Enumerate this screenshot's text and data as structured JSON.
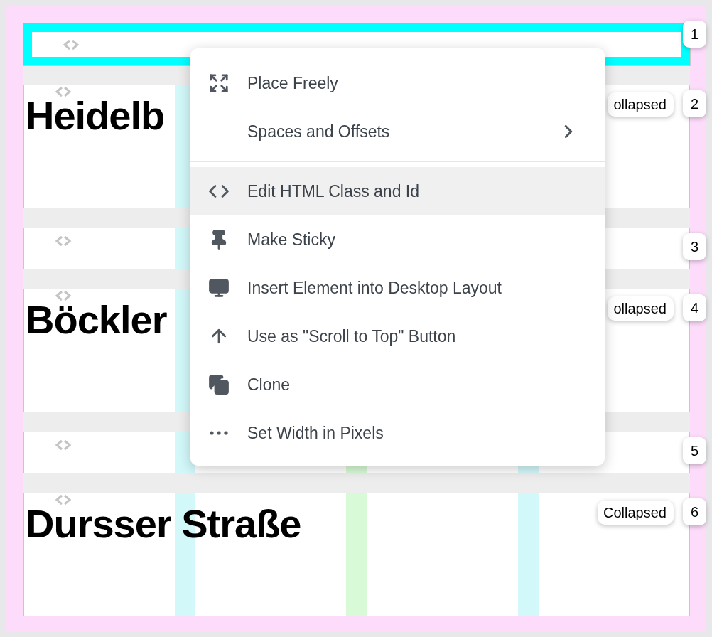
{
  "rows": [
    {
      "kind": "bar",
      "number": "1",
      "selected": true
    },
    {
      "kind": "section",
      "number": "2",
      "selected": false,
      "heading": "Heidelb",
      "badge": "ollapsed"
    },
    {
      "kind": "bar",
      "number": "3",
      "selected": false
    },
    {
      "kind": "section",
      "number": "4",
      "selected": false,
      "heading": "Böckler",
      "badge": "ollapsed"
    },
    {
      "kind": "bar",
      "number": "5",
      "selected": false
    },
    {
      "kind": "section",
      "number": "6",
      "selected": false,
      "heading": "Dursser Straße",
      "badge": "Collapsed"
    }
  ],
  "menu": {
    "items": [
      {
        "label": "Place Freely",
        "selected": false
      },
      {
        "label": "Spaces and Offsets",
        "selected": false,
        "submenu": true,
        "separator_after": true
      },
      {
        "label": "Edit HTML Class and Id",
        "selected": true
      },
      {
        "label": "Make Sticky",
        "selected": false
      },
      {
        "label": "Insert Element into Desktop Layout",
        "selected": false
      },
      {
        "label": "Use as \"Scroll to Top\" Button",
        "selected": false
      },
      {
        "label": "Clone",
        "selected": false
      },
      {
        "label": "Set Width in Pixels",
        "selected": false
      }
    ]
  }
}
